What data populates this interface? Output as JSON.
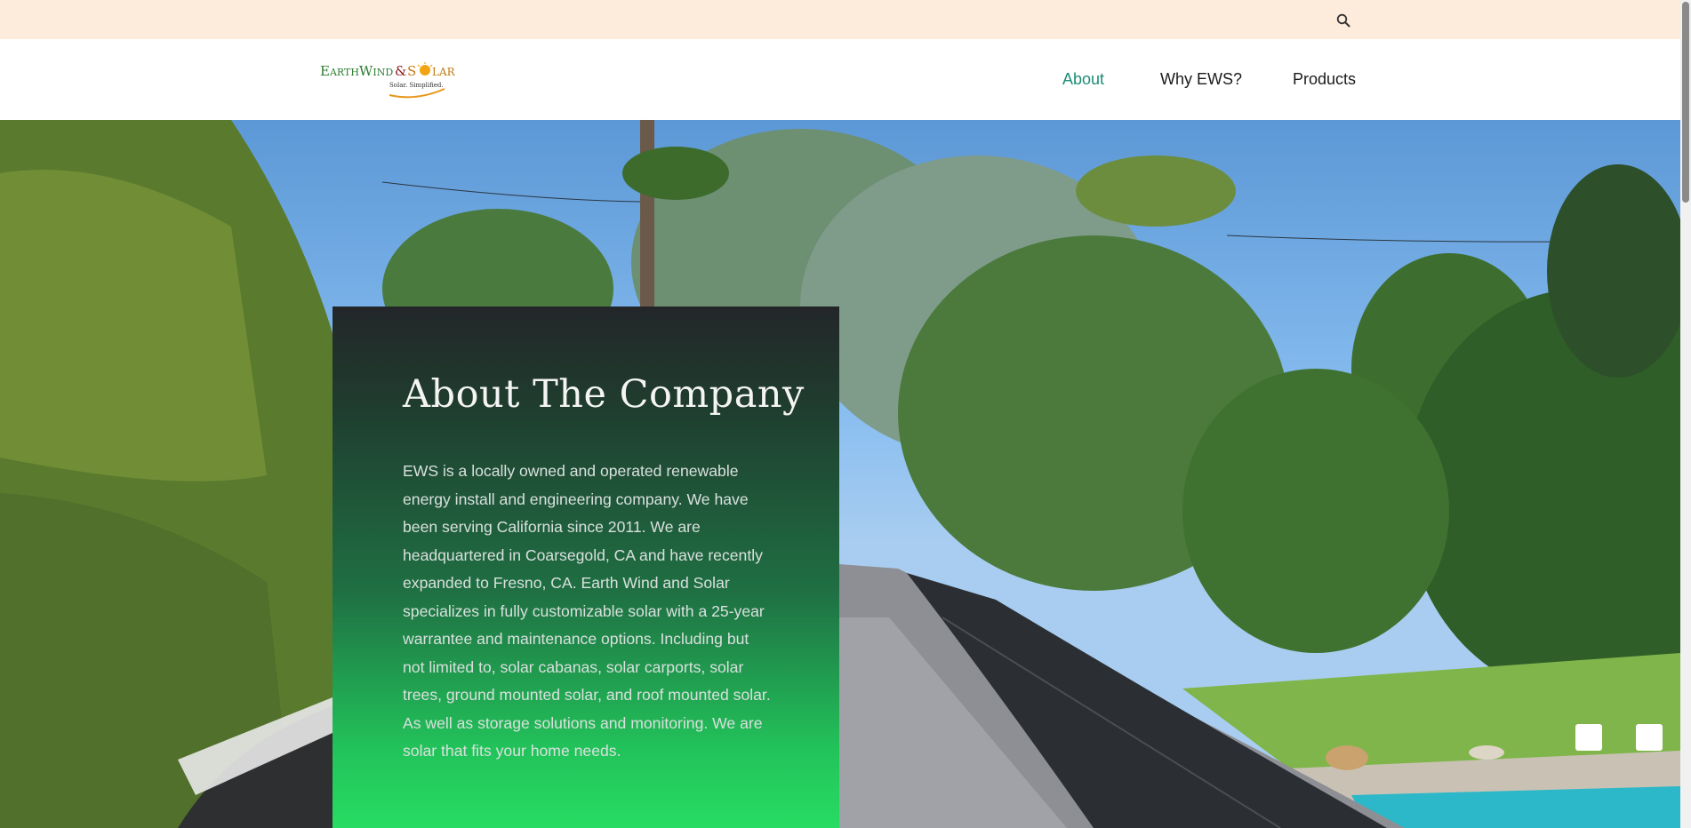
{
  "topbar": {
    "search_icon": "search-icon"
  },
  "header": {
    "logo": {
      "brand": "EarthWind&Solar",
      "tagline": "Solar. Simplified."
    },
    "nav": [
      {
        "label": "About",
        "active": true
      },
      {
        "label": "Why EWS?",
        "active": false
      },
      {
        "label": "Products",
        "active": false
      }
    ]
  },
  "hero": {
    "title": "About The Company",
    "body": "EWS is a locally owned and operated renewable energy install and engineering company.  We have been serving California since 2011. We are headquartered in Coarsegold, CA and have recently expanded to Fresno, CA. Earth Wind and Solar specializes in fully customizable solar with a 25-year warrantee and maintenance options. Including but not limited to, solar cabanas, solar carports, solar trees, ground mounted solar, and roof mounted solar. As well as storage solutions and monitoring. We are solar that fits your home needs."
  },
  "colors": {
    "topbar_bg": "#fdebdb",
    "nav_active": "#1e8c78",
    "card_top": "#232629",
    "card_bottom": "#27dc63"
  }
}
